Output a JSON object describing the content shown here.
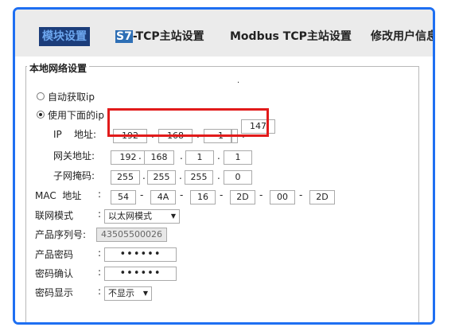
{
  "tabs": [
    {
      "label": "模块设置",
      "active": true
    },
    {
      "s7_prefix": "S7",
      "label": "-TCP主站设置"
    },
    {
      "label": "Modbus TCP主站设置"
    },
    {
      "label": "修改用户信息"
    }
  ],
  "section": {
    "title": "本地网络设置",
    "dot": "."
  },
  "ip_mode": {
    "auto_label": "自动获取ip",
    "manual_label": "使用下面的ip",
    "selected": "manual"
  },
  "ip": {
    "label": "IP    地址:",
    "octets": [
      "192",
      "168",
      "1",
      "147"
    ]
  },
  "gateway": {
    "label": "网关地址:",
    "octets": [
      "192",
      "168",
      "1",
      "1"
    ]
  },
  "subnet": {
    "label": "子网掩码:",
    "octets": [
      "255",
      "255",
      "255",
      "0"
    ]
  },
  "mac": {
    "label": "MAC  地址",
    "colon": ":",
    "parts": [
      "54",
      "4A",
      "16",
      "2D",
      "00",
      "2D"
    ]
  },
  "network_mode": {
    "label": "联网模式",
    "colon": ":",
    "value": "以太网模式"
  },
  "serial": {
    "label": "产品序列号:",
    "value": "43505500026"
  },
  "password": {
    "label": "产品密码",
    "colon": ":",
    "value": "••••••"
  },
  "password_confirm": {
    "label": "密码确认",
    "colon": ":",
    "value": "••••••"
  },
  "password_display": {
    "label": "密码显示",
    "colon": ":",
    "value": "不显示"
  },
  "colors": {
    "frame": "#1e6ff2",
    "highlight": "#e11b1b",
    "active_tab_bg": "#1c3d7a",
    "active_tab_text": "#6da7ef"
  }
}
